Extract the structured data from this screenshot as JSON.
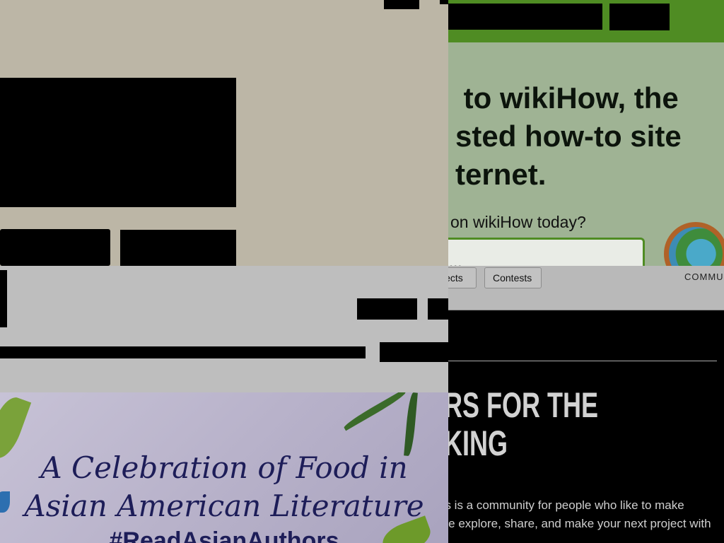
{
  "wikihow": {
    "hero_text": " to wikiHow, the\nsted how-to site\nternet.",
    "subtitle": "on wikiHow today?",
    "search_value": "...",
    "accent_color": "#4f8c23",
    "globe_icon": "globe-icon"
  },
  "instructables": {
    "nav": {
      "projects_label": "jects",
      "contests_label": "Contests",
      "community_label": "COMMUN"
    },
    "headline": "RS FOR THE\nKING",
    "body": "es is a community for people who like to make\nme explore, share, and make your next project with"
  },
  "book": {
    "title": "A Celebration of Food in\nAsian American Literature",
    "tag": "#ReadAsianAuthors"
  }
}
